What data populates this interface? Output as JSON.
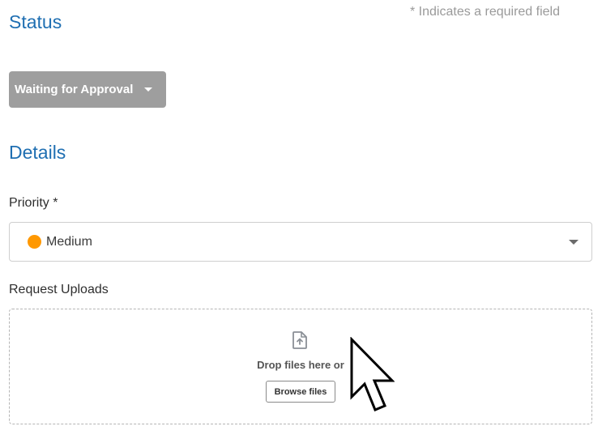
{
  "required_note": "* Indicates a required field",
  "status": {
    "title": "Status",
    "selected": "Waiting for Approval",
    "caret_icon": "caret-down-icon"
  },
  "details": {
    "title": "Details",
    "priority": {
      "label": "Priority *",
      "value": "Medium",
      "dot_color": "#ff9800",
      "caret_icon": "chevron-down-icon"
    },
    "uploads": {
      "label": "Request Uploads",
      "icon": "file-upload-icon",
      "drop_text": "Drop files here or",
      "browse_label": "Browse files"
    }
  },
  "colors": {
    "accent": "#1f6fb2",
    "status_badge": "#9e9e9e"
  }
}
